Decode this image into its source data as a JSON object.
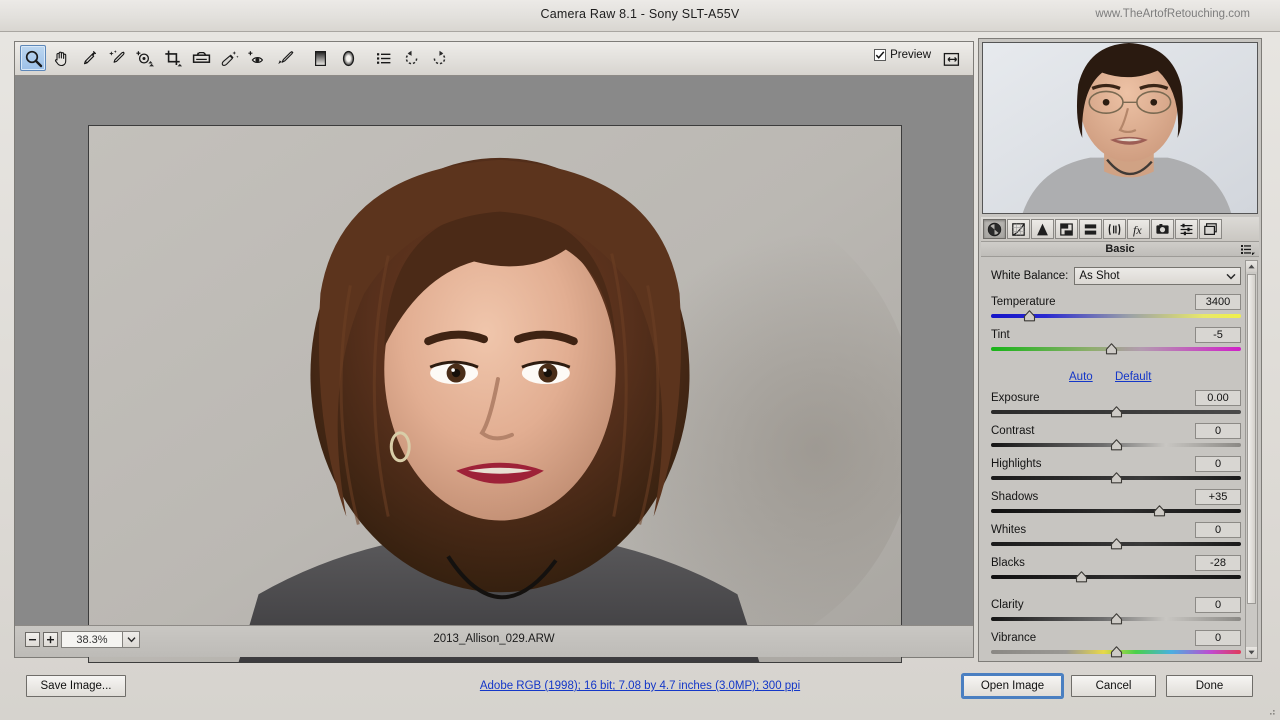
{
  "titlebar": {
    "title": "Camera Raw 8.1  -  Sony SLT-A55V",
    "watermark": "www.TheArtofRetouching.com"
  },
  "toolbar": {
    "tools": [
      {
        "name": "zoom-tool",
        "label": "Zoom Tool",
        "selected": true
      },
      {
        "name": "hand-tool",
        "label": "Hand Tool",
        "selected": false
      },
      {
        "name": "white-balance-tool",
        "label": "White Balance Tool",
        "selected": false
      },
      {
        "name": "color-sampler-tool",
        "label": "Color Sampler Tool",
        "selected": false
      },
      {
        "name": "targeted-adjustment-tool",
        "label": "Targeted Adjustment Tool",
        "selected": false
      },
      {
        "name": "crop-tool",
        "label": "Crop Tool",
        "selected": false
      },
      {
        "name": "straighten-tool",
        "label": "Straighten Tool",
        "selected": false
      },
      {
        "name": "spot-removal-tool",
        "label": "Spot Removal",
        "selected": false
      },
      {
        "name": "red-eye-removal-tool",
        "label": "Red Eye Removal",
        "selected": false
      },
      {
        "name": "adjustment-brush-tool",
        "label": "Adjustment Brush",
        "selected": false
      },
      {
        "name": "graduated-filter-tool",
        "label": "Graduated Filter",
        "selected": false
      },
      {
        "name": "radial-filter-tool",
        "label": "Radial Filter",
        "selected": false
      },
      {
        "name": "preferences-tool",
        "label": "Open Preferences Dialog",
        "selected": false
      },
      {
        "name": "rotate-left-tool",
        "label": "Rotate Image Counterclockwise",
        "selected": false
      },
      {
        "name": "rotate-right-tool",
        "label": "Rotate Image Clockwise",
        "selected": false
      }
    ],
    "preview_label": "Preview",
    "preview_checked": true,
    "fullscreen_label": "Toggle Full Screen Mode"
  },
  "statusbar": {
    "zoom_level": "38.3%",
    "zoom_out_label": "−",
    "zoom_in_label": "+",
    "filename": "2013_Allison_029.ARW"
  },
  "panel": {
    "tabs": [
      {
        "name": "tab-basic",
        "label": "Basic",
        "selected": true
      },
      {
        "name": "tab-tone-curve",
        "label": "Tone Curve",
        "selected": false
      },
      {
        "name": "tab-detail",
        "label": "Detail",
        "selected": false
      },
      {
        "name": "tab-hsl-grayscale",
        "label": "HSL / Grayscale",
        "selected": false
      },
      {
        "name": "tab-split-toning",
        "label": "Split Toning",
        "selected": false
      },
      {
        "name": "tab-lens-corrections",
        "label": "Lens Corrections",
        "selected": false
      },
      {
        "name": "tab-effects",
        "label": "Effects",
        "selected": false
      },
      {
        "name": "tab-camera-calibration",
        "label": "Camera Calibration",
        "selected": false
      },
      {
        "name": "tab-presets",
        "label": "Presets",
        "selected": false
      },
      {
        "name": "tab-snapshots",
        "label": "Snapshots",
        "selected": false
      }
    ],
    "title": "Basic",
    "white_balance_label": "White Balance:",
    "white_balance_value": "As Shot",
    "auto_label": "Auto",
    "default_label": "Default",
    "sliders": [
      {
        "name": "temperature",
        "label": "Temperature",
        "value": "3400",
        "pos": 15,
        "rail": "grad-temp"
      },
      {
        "name": "tint",
        "label": "Tint",
        "value": "-5",
        "pos": 48,
        "rail": "grad-tint"
      },
      {
        "name": "exposure",
        "label": "Exposure",
        "value": "0.00",
        "pos": 50,
        "rail": "grad-flat"
      },
      {
        "name": "contrast",
        "label": "Contrast",
        "value": "0",
        "pos": 50,
        "rail": "grad-gray"
      },
      {
        "name": "highlights",
        "label": "Highlights",
        "value": "0",
        "pos": 50,
        "rail": "grad-dark"
      },
      {
        "name": "shadows",
        "label": "Shadows",
        "value": "+35",
        "pos": 67,
        "rail": "grad-shadow"
      },
      {
        "name": "whites",
        "label": "Whites",
        "value": "0",
        "pos": 50,
        "rail": "grad-dark"
      },
      {
        "name": "blacks",
        "label": "Blacks",
        "value": "-28",
        "pos": 36,
        "rail": "grad-shadow"
      },
      {
        "name": "clarity",
        "label": "Clarity",
        "value": "0",
        "pos": 50,
        "rail": "grad-gray"
      },
      {
        "name": "vibrance",
        "label": "Vibrance",
        "value": "0",
        "pos": 50,
        "rail": "grad-vib"
      }
    ]
  },
  "bottom": {
    "save_image_label": "Save Image...",
    "workflow_link": "Adobe RGB (1998); 16 bit; 7.08 by 4.7 inches (3.0MP); 300 ppi",
    "open_image_label": "Open Image",
    "cancel_label": "Cancel",
    "done_label": "Done"
  },
  "colors": {
    "accent_link": "#1437c8",
    "selected_tool": "#9cc0e8",
    "canvas_bg": "#898989"
  }
}
